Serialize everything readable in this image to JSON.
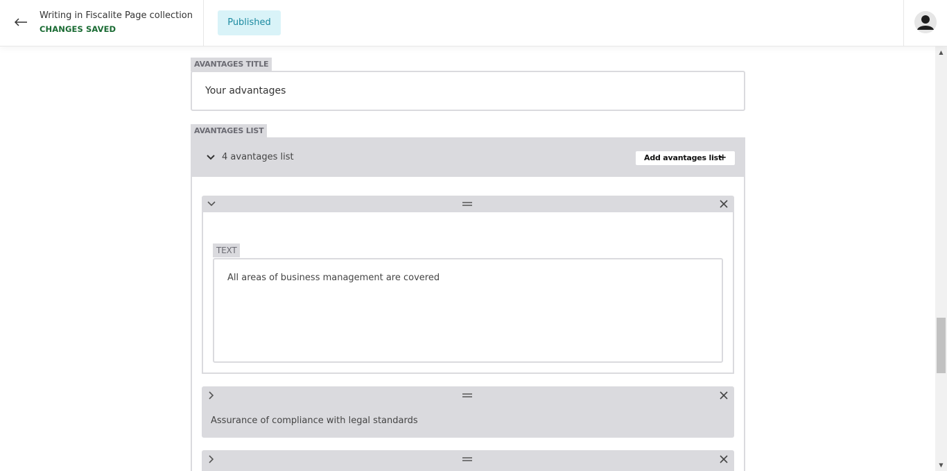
{
  "header": {
    "doc_title": "Writing in Fiscalite Page collection",
    "save_status": "CHANGES SAVED",
    "status_pill": "Published",
    "back_icon": "arrow-left-icon",
    "avatar_icon": "user-avatar-icon"
  },
  "advantages_title": {
    "label": "AVANTAGES TITLE",
    "value": "Your advantages"
  },
  "advantages_list": {
    "label": "AVANTAGES LIST",
    "count_text": "4 avantages list",
    "add_button_label": "Add avantages list",
    "add_icon": "+",
    "items": [
      {
        "expanded": true,
        "field_label": "TEXT",
        "text": "All areas of business management are covered"
      },
      {
        "expanded": false,
        "text": "Assurance of compliance with legal standards"
      },
      {
        "expanded": false,
        "text": ""
      }
    ]
  },
  "colors": {
    "accent_teal": "#1b8aa0",
    "pill_bg": "#d9f3f8",
    "saved_green": "#1a6b33",
    "panel_gray": "#dadade"
  }
}
